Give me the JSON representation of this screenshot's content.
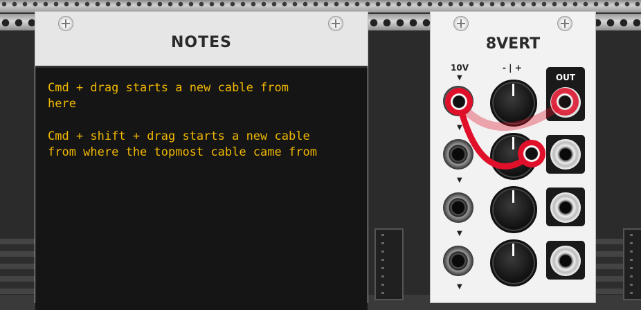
{
  "notes_module": {
    "title": "NOTES",
    "lines": [
      "Cmd + drag starts a new cable from",
      "here",
      "",
      "Cmd + shift + drag starts a new cable",
      "from where the topmost cable came from"
    ]
  },
  "vert_module": {
    "title": "8VERT",
    "label_10v": "10V",
    "label_polarity": "- | +",
    "label_out": "OUT",
    "rows": 4
  },
  "colors": {
    "note_text": "#f0b800",
    "cable": "#e0102a",
    "panel": "#e6e6e6",
    "screen": "#151515"
  }
}
